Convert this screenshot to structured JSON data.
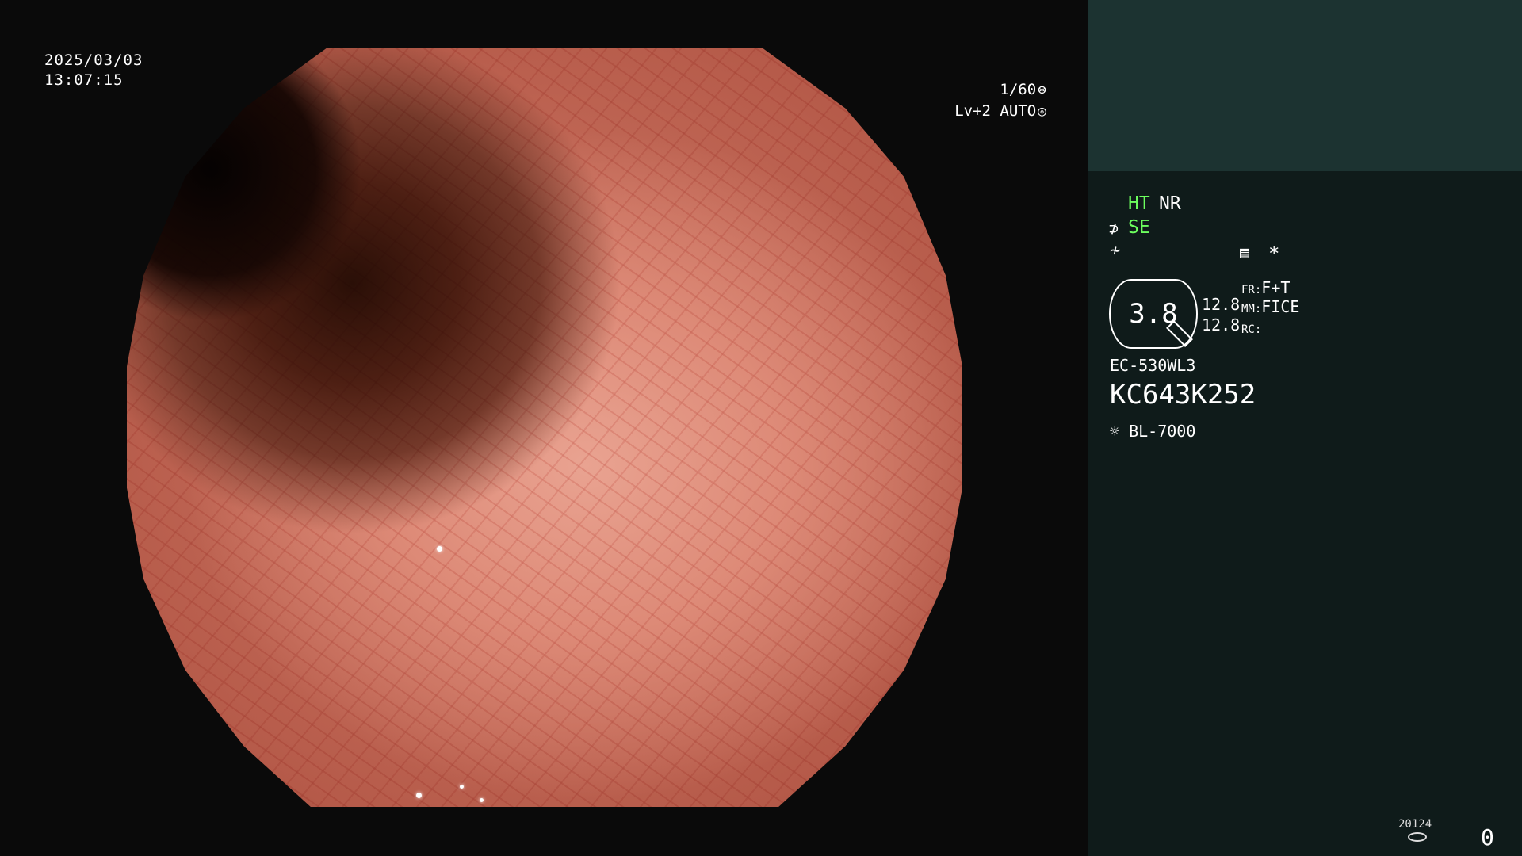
{
  "overlay": {
    "date": "2025/03/03",
    "time": "13:07:15",
    "shutter": "1/60",
    "shutter_icon": "aperture-icon",
    "level": "Lv+2 AUTO",
    "level_icon": "auto-iris-icon"
  },
  "panel": {
    "ht_label": "HT",
    "nr_label": "NR",
    "se_label": "SE",
    "enhance_icon": "structure-enhance-icon",
    "color_icon": "color-tone-icon",
    "menu_icon": "image-settings-icon",
    "asterisk": "*",
    "zoom_value": "3.8",
    "stat1": "12.8",
    "stat2": "12.8",
    "fr_label": "FR:",
    "fr_value": "F+T",
    "mm_label": "MM:",
    "mm_value": "FICE",
    "rc_label": "RC:",
    "scope_model": "EC-530WL3",
    "scope_id": "KC643K252",
    "light_icon": "light-source-icon",
    "light_source": "BL-7000",
    "counter_label": "20124",
    "counter_icon": "storage-icon",
    "capture_count": "0"
  },
  "colors": {
    "panel_bg": "#0f1b1a",
    "panel_top_bg": "#1c3331",
    "highlight": "#6cff5e"
  }
}
